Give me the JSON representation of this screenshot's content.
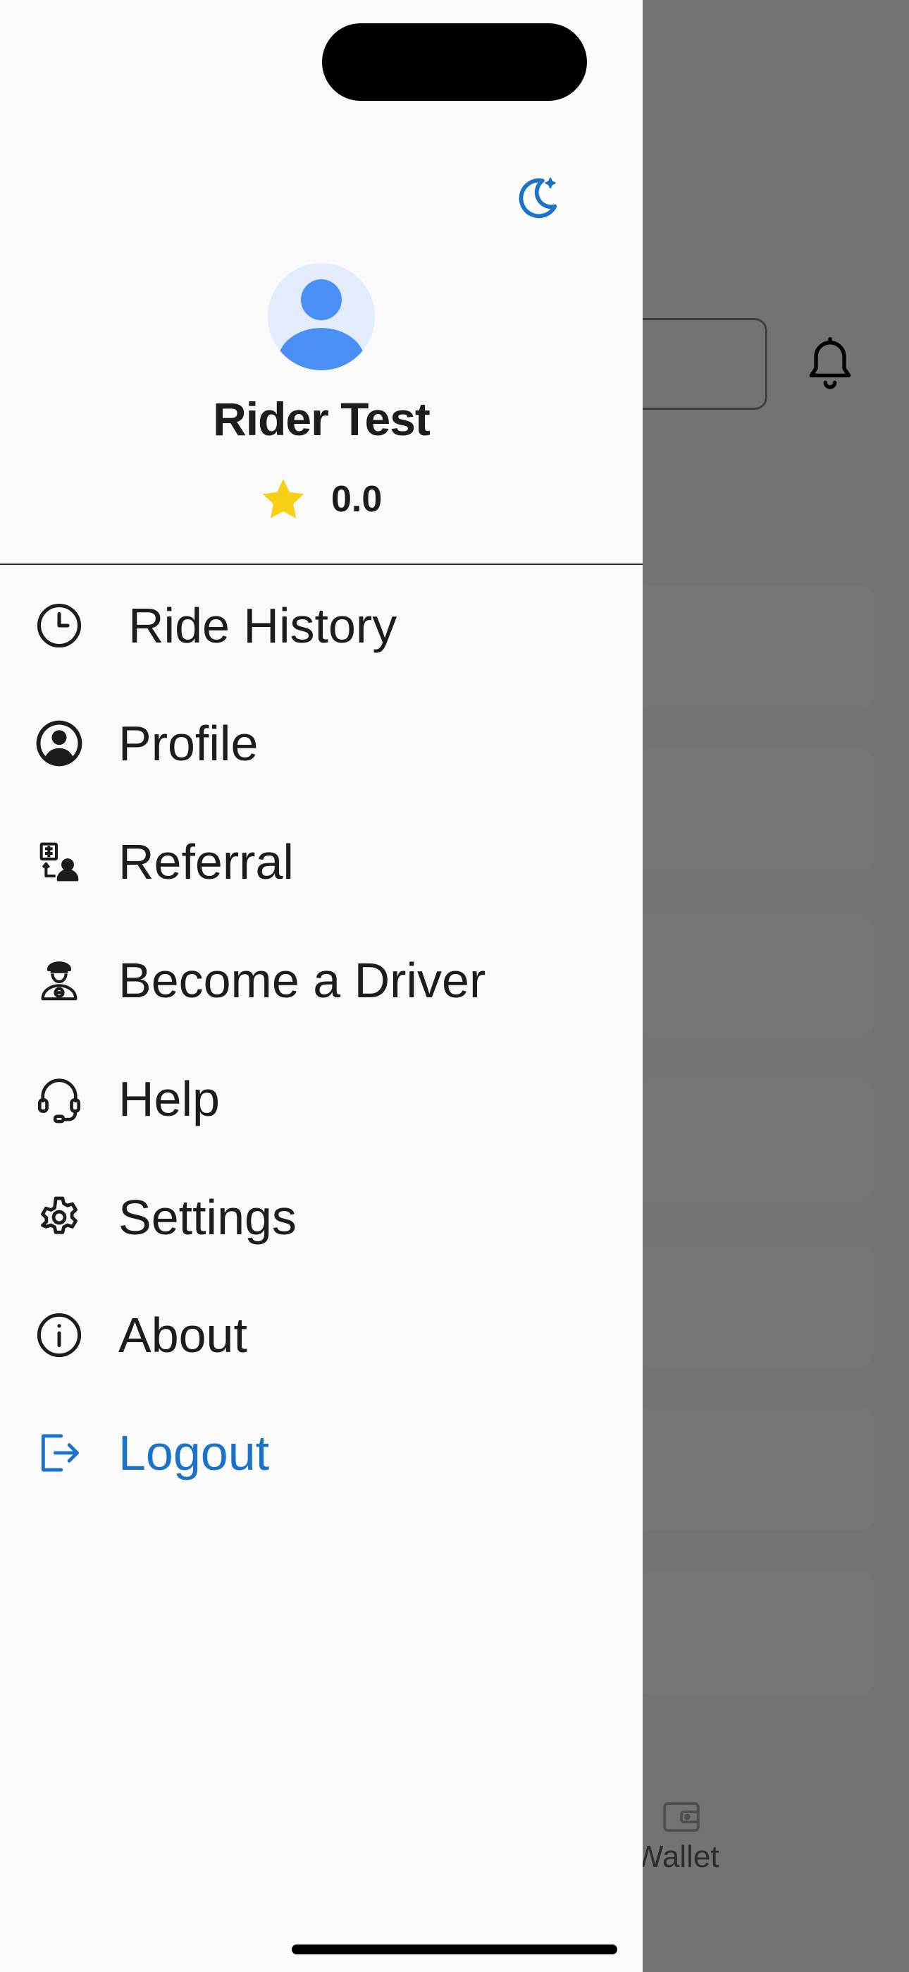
{
  "background": {
    "wallet_label": "Wallet"
  },
  "drawer": {
    "theme_toggle_icon": "moon-icon",
    "user": {
      "name": "Rider Test",
      "rating": "0.0",
      "avatar_icon": "avatar-icon"
    },
    "menu": [
      {
        "label": "Ride History",
        "icon": "clock-icon"
      },
      {
        "label": "Profile",
        "icon": "profile-icon"
      },
      {
        "label": "Referral",
        "icon": "referral-icon"
      },
      {
        "label": "Become a Driver",
        "icon": "driver-icon"
      },
      {
        "label": "Help",
        "icon": "headset-icon"
      },
      {
        "label": "Settings",
        "icon": "gear-icon"
      },
      {
        "label": "About",
        "icon": "info-icon"
      },
      {
        "label": "Logout",
        "icon": "logout-icon"
      }
    ]
  },
  "colors": {
    "accent": "#1a72c9",
    "avatar_fill": "#4a8ff5",
    "avatar_bg": "#e3ecfd",
    "star": "#f7cf14",
    "overlay": "#737373",
    "drawer_bg": "#fafafa"
  }
}
